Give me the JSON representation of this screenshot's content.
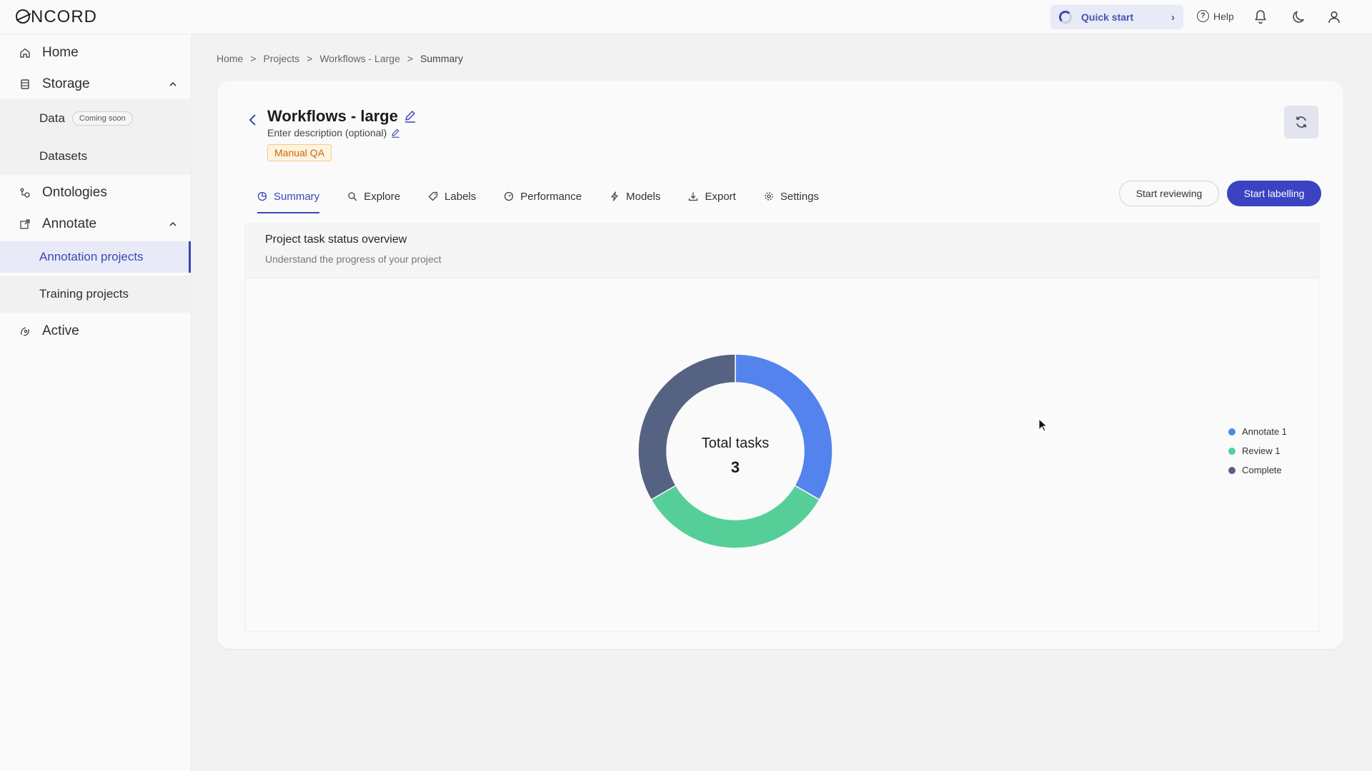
{
  "topbar": {
    "logo": "NCORD",
    "quick_start": "Quick start",
    "help": "Help"
  },
  "sidebar": {
    "home": "Home",
    "storage": "Storage",
    "data": "Data",
    "coming_soon": "Coming soon",
    "datasets": "Datasets",
    "ontologies": "Ontologies",
    "annotate": "Annotate",
    "annotation_projects": "Annotation projects",
    "training_projects": "Training projects",
    "active": "Active"
  },
  "breadcrumb": {
    "items": [
      "Home",
      "Projects",
      "Workflows - Large",
      "Summary"
    ],
    "separator": ">"
  },
  "project": {
    "title": "Workflows - large",
    "description": "Enter description (optional)",
    "tag": "Manual QA"
  },
  "tabs": [
    "Summary",
    "Explore",
    "Labels",
    "Performance",
    "Models",
    "Export",
    "Settings"
  ],
  "actions": {
    "start_reviewing": "Start reviewing",
    "start_labelling": "Start labelling"
  },
  "panel": {
    "title": "Project task status overview",
    "subtitle": "Understand the progress of your project"
  },
  "chart_data": {
    "type": "pie",
    "center_label": "Total tasks",
    "center_value": "3",
    "categories": [
      "Annotate 1",
      "Review 1",
      "Complete"
    ],
    "values": [
      1,
      1,
      1
    ],
    "colors": [
      "#5483ee",
      "#55cf97",
      "#556282"
    ],
    "legend_position": "right"
  },
  "colors": {
    "accent": "#3b47b5",
    "primary_button": "#3a44c2",
    "tag_text": "#c56a10"
  }
}
